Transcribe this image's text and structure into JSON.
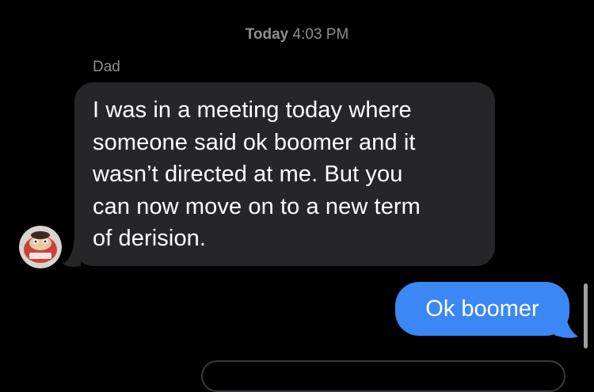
{
  "thread": {
    "timestamp_day": "Today",
    "timestamp_time": "4:03 PM"
  },
  "incoming": {
    "sender_name": "Dad",
    "avatar": "contact-photo",
    "lines": [
      "I was in a meeting today where",
      "someone said ok boomer and it",
      "wasn’t directed at me. But you",
      "can now move on to a new term",
      "of derision."
    ],
    "bubble_color": "#262629"
  },
  "outgoing": {
    "text": "Ok boomer",
    "bubble_color": "#3b87f6"
  },
  "colors": {
    "background": "#000000",
    "meta_text": "#8e8e93"
  }
}
